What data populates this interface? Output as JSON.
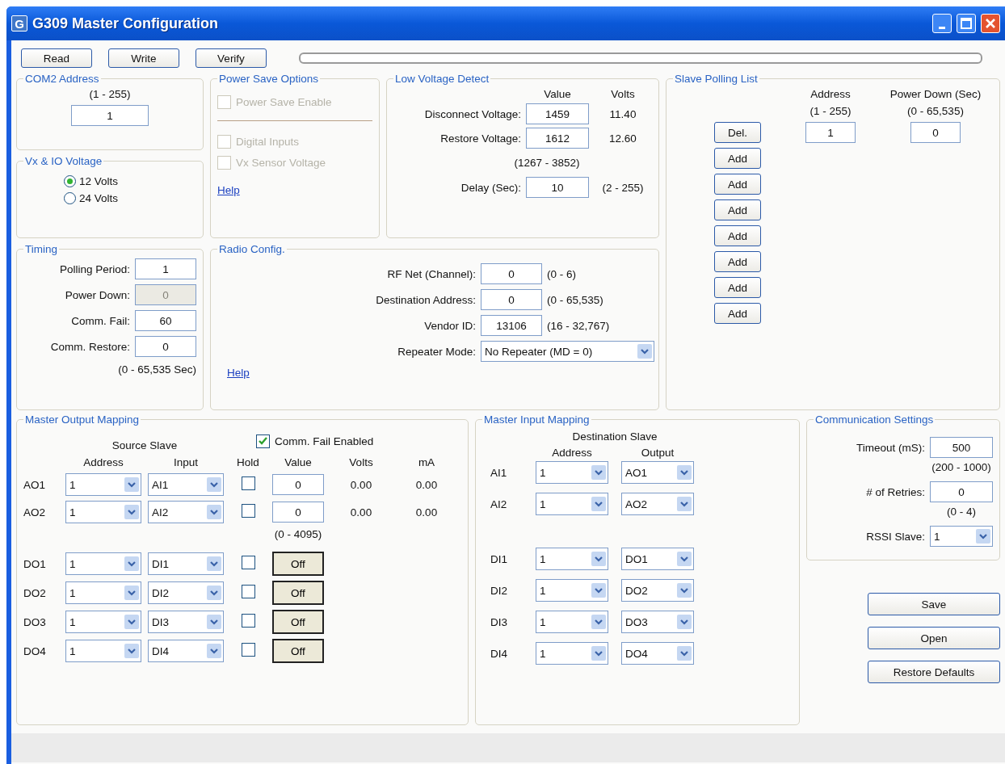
{
  "window": {
    "title": "G309 Master Configuration",
    "logo": "G"
  },
  "toolbar": {
    "buttons": [
      "Read",
      "Write",
      "Verify"
    ]
  },
  "com2_address": {
    "title": "COM2 Address",
    "range": "(1 - 255)",
    "value": "1"
  },
  "vx_io_voltage": {
    "title": "Vx & IO Voltage",
    "options": [
      {
        "label": "12 Volts",
        "selected": true
      },
      {
        "label": "24 Volts",
        "selected": false
      }
    ]
  },
  "power_save": {
    "title": "Power Save Options",
    "enable": {
      "label": "Power Save Enable",
      "checked": false,
      "disabled": true
    },
    "options": [
      {
        "label": "Digital Inputs",
        "checked": false,
        "disabled": true
      },
      {
        "label": "Vx Sensor Voltage",
        "checked": false,
        "disabled": true
      }
    ],
    "help": "Help"
  },
  "low_voltage": {
    "title": "Low Voltage Detect",
    "headers": [
      "Value",
      "Volts"
    ],
    "rows": [
      {
        "label": "Disconnect Voltage:",
        "value": "1459",
        "volts": "11.40"
      },
      {
        "label": "Restore Voltage:",
        "value": "1612",
        "volts": "12.60"
      }
    ],
    "range": "(1267 - 3852)",
    "delay": {
      "label": "Delay (Sec):",
      "value": "10",
      "range": "(2 - 255)"
    }
  },
  "slave_polling": {
    "title": "Slave Polling List",
    "headers": [
      {
        "title": "Address",
        "range": "(1 - 255)"
      },
      {
        "title": "Power Down (Sec)",
        "range": "(0 - 65,535)"
      }
    ],
    "entries": [
      {
        "button": "Del.",
        "address": "1",
        "power_down": "0"
      }
    ],
    "buttons": [
      "Add",
      "Add",
      "Add",
      "Add",
      "Add",
      "Add",
      "Add"
    ]
  },
  "timing": {
    "title": "Timing",
    "fields": [
      {
        "label": "Polling Period:",
        "value": "1",
        "disabled": false
      },
      {
        "label": "Power Down:",
        "value": "0",
        "disabled": true
      },
      {
        "label": "Comm. Fail:",
        "value": "60",
        "disabled": false
      },
      {
        "label": "Comm. Restore:",
        "value": "0",
        "disabled": false
      }
    ],
    "range": "(0 - 65,535 Sec)"
  },
  "radio": {
    "title": "Radio Config.",
    "fields": [
      {
        "kind": "input",
        "label": "RF Net (Channel):",
        "value": "0",
        "range": "(0 - 6)"
      },
      {
        "kind": "input",
        "label": "Destination Address:",
        "value": "0",
        "range": "(0 - 65,535)"
      },
      {
        "kind": "input",
        "label": "Vendor ID:",
        "value": "13106",
        "range": "(16 - 32,767)"
      },
      {
        "kind": "select",
        "label": "Repeater Mode:",
        "value": "No Repeater (MD = 0)"
      }
    ],
    "help": "Help"
  },
  "output_mapping": {
    "title": "Master Output Mapping",
    "comm_fail": {
      "label": "Comm. Fail Enabled",
      "checked": true
    },
    "group_label": "Source Slave",
    "headers": [
      "Address",
      "Input",
      "Hold",
      "Value",
      "Volts",
      "mA"
    ],
    "rows": [
      {
        "kind": "analog",
        "label": "AO1",
        "address": "1",
        "input": "AI1",
        "hold": false,
        "value": "0",
        "volts": "0.00",
        "ma": "0.00"
      },
      {
        "kind": "analog",
        "label": "AO2",
        "address": "1",
        "input": "AI2",
        "hold": false,
        "value": "0",
        "volts": "0.00",
        "ma": "0.00"
      },
      {
        "kind": "digital",
        "label": "DO1",
        "address": "1",
        "input": "DI1",
        "hold": false,
        "value": "Off"
      },
      {
        "kind": "digital",
        "label": "DO2",
        "address": "1",
        "input": "DI2",
        "hold": false,
        "value": "Off"
      },
      {
        "kind": "digital",
        "label": "DO3",
        "address": "1",
        "input": "DI3",
        "hold": false,
        "value": "Off"
      },
      {
        "kind": "digital",
        "label": "DO4",
        "address": "1",
        "input": "DI4",
        "hold": false,
        "value": "Off"
      }
    ],
    "value_range": "(0 - 4095)"
  },
  "input_mapping": {
    "title": "Master Input Mapping",
    "group_label": "Destination Slave",
    "headers": [
      "Address",
      "Output"
    ],
    "rows": [
      {
        "kind": "analog",
        "label": "AI1",
        "address": "1",
        "output": "AO1"
      },
      {
        "kind": "analog",
        "label": "AI2",
        "address": "1",
        "output": "AO2"
      },
      {
        "kind": "digital",
        "label": "DI1",
        "address": "1",
        "output": "DO1"
      },
      {
        "kind": "digital",
        "label": "DI2",
        "address": "1",
        "output": "DO2"
      },
      {
        "kind": "digital",
        "label": "DI3",
        "address": "1",
        "output": "DO3"
      },
      {
        "kind": "digital",
        "label": "DI4",
        "address": "1",
        "output": "DO4"
      }
    ]
  },
  "comm_settings": {
    "title": "Communication Settings",
    "fields": [
      {
        "kind": "input",
        "label": "Timeout (mS):",
        "value": "500",
        "range": "(200 - 1000)"
      },
      {
        "kind": "input",
        "label": "# of Retries:",
        "value": "0",
        "range": "(0 - 4)"
      },
      {
        "kind": "select",
        "label": "RSSI Slave:",
        "value": "1"
      }
    ]
  },
  "actions": [
    "Save",
    "Open",
    "Restore Defaults"
  ]
}
